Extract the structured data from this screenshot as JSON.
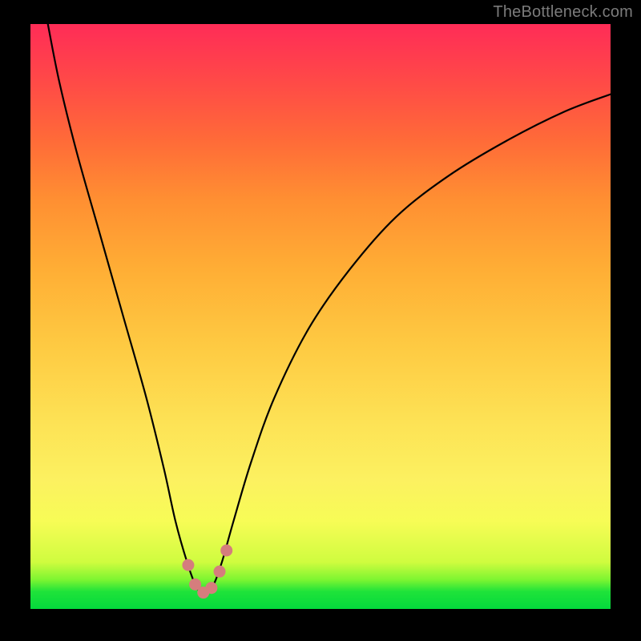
{
  "watermark": "TheBottleneck.com",
  "colors": {
    "page_bg": "#000000",
    "curve": "#000000",
    "marker_fill": "#d57d7d",
    "marker_stroke": "#b05c5c",
    "gradient_stops": [
      "#04d93c",
      "#1fe33a",
      "#7df531",
      "#cffc3f",
      "#f7fc56",
      "#fcf160",
      "#fde255",
      "#feca42",
      "#ffae35",
      "#ff8f32",
      "#ff6b38",
      "#ff4a47",
      "#ff2c57"
    ]
  },
  "chart_data": {
    "type": "line",
    "title": "",
    "xlabel": "",
    "ylabel": "",
    "xlim": [
      0,
      100
    ],
    "ylim": [
      0,
      100
    ],
    "legend": false,
    "grid": false,
    "series": [
      {
        "name": "bottleneck-curve",
        "x": [
          3,
          5,
          8,
          12,
          16,
          20,
          23,
          25,
          27,
          28.5,
          30,
          31.5,
          33,
          35,
          38,
          42,
          48,
          55,
          63,
          72,
          82,
          92,
          100
        ],
        "values": [
          100,
          90,
          78,
          64,
          50,
          36,
          24,
          15,
          8,
          4,
          2.5,
          4,
          8,
          15,
          25,
          36,
          48,
          58,
          67,
          74,
          80,
          85,
          88
        ]
      }
    ],
    "markers": [
      {
        "x": 27.2,
        "y": 7.5
      },
      {
        "x": 28.4,
        "y": 4.2
      },
      {
        "x": 29.8,
        "y": 2.8
      },
      {
        "x": 31.2,
        "y": 3.6
      },
      {
        "x": 32.6,
        "y": 6.4
      },
      {
        "x": 33.8,
        "y": 10.0
      }
    ]
  }
}
